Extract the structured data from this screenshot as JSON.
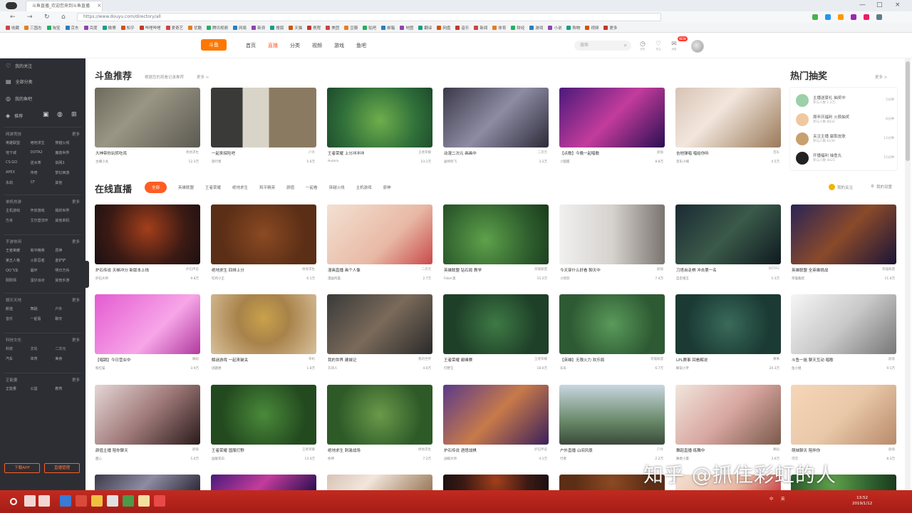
{
  "browser": {
    "tab_title": "斗鱼直播_欢迎您来到斗鱼直播",
    "url": "https://www.douyu.com/directory/all",
    "bookmarks": [
      "收藏",
      "三国志",
      "淘宝",
      "京东",
      "百度",
      "微博",
      "知乎",
      "哔哩哔哩",
      "爱奇艺",
      "优酷",
      "腾讯视频",
      "网易",
      "新浪",
      "搜狐",
      "天猫",
      "携程",
      "美团",
      "豆瓣",
      "贴吧",
      "邮箱",
      "地图",
      "翻译",
      "网盘",
      "音乐",
      "新闻",
      "体育",
      "财经",
      "游戏",
      "小说",
      "购物",
      "视频",
      "更多"
    ]
  },
  "header": {
    "logo": "斗鱼",
    "nav": [
      "首页",
      "直播",
      "分类",
      "视频",
      "游戏",
      "鱼吧"
    ],
    "active_nav_index": 1,
    "search_placeholder": "搜索",
    "icons": [
      {
        "name": "history-icon",
        "glyph": "◷",
        "label": "历史"
      },
      {
        "name": "follow-icon",
        "glyph": "♡",
        "label": "关注"
      },
      {
        "name": "message-icon",
        "glyph": "✉",
        "label": "消息"
      }
    ],
    "badge": "NEW"
  },
  "sidebar": {
    "top_items": [
      {
        "icon": "♡",
        "label": "我的关注"
      },
      {
        "icon": "▤",
        "label": "全部分类"
      },
      {
        "icon": "◎",
        "label": "我的鱼吧"
      },
      {
        "icon": "◈",
        "label": "推荐"
      }
    ],
    "sections": [
      {
        "title": "网游竞技",
        "more": "更多",
        "items": [
          "英雄联盟",
          "绝地求生",
          "穿越火线",
          "地下城",
          "DOTA2",
          "魔兽世界",
          "CS:GO",
          "逆水寒",
          "剑网3",
          "APEX",
          "传奇",
          "梦幻西游",
          "永劫",
          "CF",
          "其他"
        ]
      },
      {
        "title": "单机热游",
        "more": "更多",
        "items": [
          "主机游戏",
          "怀旧游戏",
          "我的世界",
          "方舟",
          "艾尔登法环",
          "其他单机"
        ]
      },
      {
        "title": "手游休闲",
        "more": "更多",
        "items": [
          "王者荣耀",
          "和平精英",
          "原神",
          "第五人格",
          "火影忍者",
          "金铲铲",
          "QQ飞车",
          "崩坏",
          "明日方舟",
          "阴阳师",
          "蛋仔派对",
          "其他手游"
        ]
      },
      {
        "title": "娱乐天地",
        "more": "更多",
        "items": [
          "颜值",
          "舞蹈",
          "户外",
          "音乐",
          "一起看",
          "聊天"
        ]
      },
      {
        "title": "科技文化",
        "more": "更多",
        "items": [
          "科技",
          "文化",
          "二次元",
          "汽车",
          "体育",
          "美食"
        ]
      },
      {
        "title": "正能量",
        "more": "更多",
        "items": [
          "正能量",
          "公益",
          "教育"
        ]
      }
    ],
    "buttons": [
      "下载APP",
      "直播管理"
    ]
  },
  "recommend": {
    "title": "斗鱼推荐",
    "subtitle": "根据您的观看记录推荐",
    "more": "更多 >",
    "cards": [
      {
        "title": "大神带你玩转吃鸡",
        "tag": "绝地求生",
        "name": "主播小龙",
        "views": "12.3万"
      },
      {
        "title": "一起来探险吧",
        "tag": "户外",
        "name": "旅行者",
        "views": "5.6万"
      },
      {
        "title": "王者荣耀 上分冲冲冲",
        "tag": "王者荣耀",
        "name": "Aurora",
        "views": "23.1万"
      },
      {
        "title": "动漫二次元 画画中",
        "tag": "二次元",
        "name": "画师阿飞",
        "views": "3.2万"
      },
      {
        "title": "【点歌】今晚一起唱歌",
        "tag": "颜值",
        "name": "小甜甜",
        "views": "8.8万"
      },
      {
        "title": "吉他弹唱 唱给你听",
        "tag": "音乐",
        "name": "音乐小楠",
        "views": "4.5万"
      }
    ]
  },
  "hot": {
    "title": "热门抽奖",
    "more": "更多 >",
    "items": [
      {
        "title": "主播送豪礼 抽奖中",
        "sub": "参与人数 1.2万",
        "right": "5分钟"
      },
      {
        "title": "周年庆福利 火箭抽奖",
        "sub": "参与人数 8832",
        "right": "8分钟"
      },
      {
        "title": "关注主播 赢取皮肤",
        "sub": "参与人数 6230",
        "right": "12分钟"
      },
      {
        "title": "开播福利 抽鱼丸",
        "sub": "参与人数 4021",
        "right": "15分钟"
      }
    ]
  },
  "online": {
    "title": "在线直播",
    "filters": [
      "全部",
      "英雄联盟",
      "王者荣耀",
      "绝地求生",
      "和平精英",
      "颜值",
      "一起看",
      "穿越火线",
      "主机游戏",
      "原神"
    ],
    "active_filter_index": 0,
    "right_labels": [
      "我的关注",
      "我的设置"
    ],
    "cards": [
      {
        "title": "炉石传说 天梯冲分 新版本上线",
        "tag": "炉石传说",
        "name": "炉石大师",
        "views": "9.8万"
      },
      {
        "title": "绝地求生 四排上分",
        "tag": "绝地求生",
        "name": "吃鸡小王",
        "views": "6.1万"
      },
      {
        "title": "漫画直播 画个人像",
        "tag": "二次元",
        "name": "漫画阿晨",
        "views": "2.7万"
      },
      {
        "title": "英雄联盟 钻石局 教学",
        "tag": "英雄联盟",
        "name": "Faker迷",
        "views": "15.2万"
      },
      {
        "title": "今天穿什么好看 聊天中",
        "tag": "颜值",
        "name": "小欣欣",
        "views": "7.4万"
      },
      {
        "title": "刀塔自走棋 冲击第一名",
        "tag": "DOTA2",
        "name": "自走棋王",
        "views": "5.3万"
      },
      {
        "title": "英雄联盟 全英雄挑战",
        "tag": "英雄联盟",
        "name": "英雄集结",
        "views": "11.6万"
      },
      {
        "title": "【唱跳】今日营业中",
        "tag": "舞蹈",
        "name": "粉红猫",
        "views": "3.9万"
      },
      {
        "title": "解谜游戏 一起来破关",
        "tag": "单机",
        "name": "谜题君",
        "views": "1.8万"
      },
      {
        "title": "我的世界 建城记",
        "tag": "我的世界",
        "name": "方块人",
        "views": "4.6万"
      },
      {
        "title": "王者荣耀 巅峰赛",
        "tag": "王者荣耀",
        "name": "打野王",
        "views": "18.0万"
      },
      {
        "title": "【英雄】无限火力 欢乐局",
        "tag": "英雄联盟",
        "name": "乐乐",
        "views": "6.7万"
      },
      {
        "title": "LPL赛事 回看解说",
        "tag": "赛事",
        "name": "解说小宇",
        "views": "20.3万"
      },
      {
        "title": "斗鱼一姐 聊天互动 唱歌",
        "tag": "颜值",
        "name": "鱼小姐",
        "views": "9.1万"
      },
      {
        "title": "颜值主播 陪你聊天",
        "tag": "颜值",
        "name": "甜心",
        "views": "5.0万"
      },
      {
        "title": "王者荣耀 国服打野",
        "tag": "王者荣耀",
        "name": "国服李白",
        "views": "13.4万"
      },
      {
        "title": "绝地求生 刺激战场",
        "tag": "绝地求生",
        "name": "枪神",
        "views": "7.2万"
      },
      {
        "title": "炉石传说 酒馆战棋",
        "tag": "炉石传说",
        "name": "战棋大师",
        "views": "4.1万"
      },
      {
        "title": "户外直播 山间风景",
        "tag": "户外",
        "name": "行者",
        "views": "2.2万"
      },
      {
        "title": "舞蹈直播 练舞中",
        "tag": "舞蹈",
        "name": "舞者小夏",
        "views": "3.6万"
      },
      {
        "title": "萌妹聊天 陪伴你",
        "tag": "颜值",
        "name": "可可",
        "views": "8.3万"
      }
    ]
  },
  "watermark": "知乎 @抓住彩虹的人",
  "taskbar": {
    "tray": [
      "中",
      "英"
    ],
    "time": "13:52",
    "date": "2019/1/12"
  },
  "theme": {
    "accent": "#ff5d23",
    "sidebar_bg": "#2d2e33",
    "taskbar_bg": "#b8241b"
  }
}
